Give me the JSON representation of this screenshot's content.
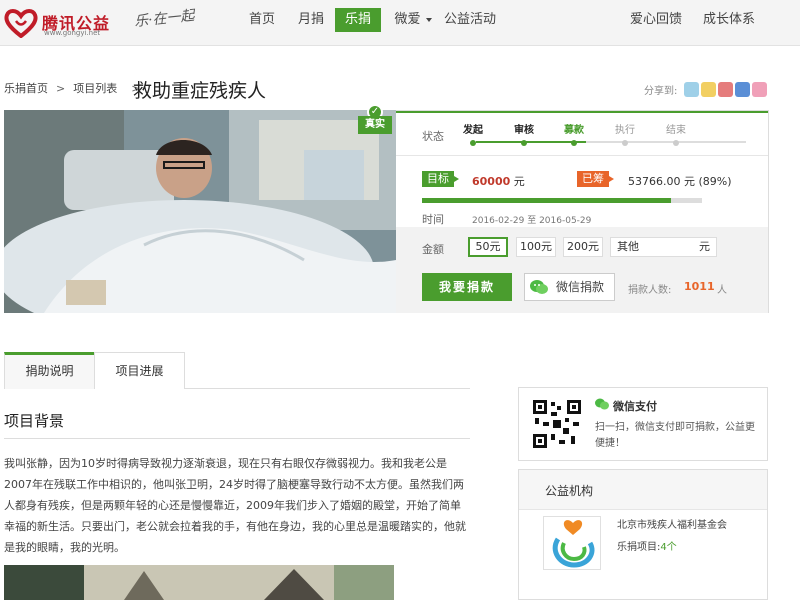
{
  "brand": {
    "logo_main": "腾讯公益",
    "logo_url": "www.gongyi.net",
    "slogan": "乐·在一起",
    "colors": {
      "accent": "#4a9d2e",
      "brand_red": "#c01c28",
      "orange": "#e8652a"
    }
  },
  "nav": {
    "items": [
      {
        "label": "首页"
      },
      {
        "label": "月捐"
      },
      {
        "label": "乐捐"
      },
      {
        "label": "微爱"
      },
      {
        "label": "公益活动"
      }
    ],
    "active": "乐捐",
    "right": [
      {
        "label": "爱心回馈"
      },
      {
        "label": "成长体系"
      }
    ]
  },
  "breadcrumb": {
    "home": "乐捐首页",
    "list": "项目列表",
    "separator": ">",
    "sep_main": ">"
  },
  "page_title": "救助重症残疾人",
  "share": {
    "label": "分享到:",
    "icons": [
      "qq-icon",
      "qzone-icon",
      "weibo-icon",
      "renren-icon",
      "kaixin-icon"
    ]
  },
  "verified_label": "真实",
  "status": {
    "label": "状态",
    "steps": [
      {
        "label": "发起",
        "state": "done"
      },
      {
        "label": "审核",
        "state": "done"
      },
      {
        "label": "募款",
        "state": "current"
      },
      {
        "label": "执行",
        "state": "todo"
      },
      {
        "label": "结束",
        "state": "todo"
      }
    ]
  },
  "funding": {
    "goal_tag": "目标",
    "goal_amount": "60000",
    "goal_unit": "元",
    "raised_tag": "已筹",
    "raised_text": "53766.00 元 (89%)",
    "progress_percent": 89,
    "time_label": "时间",
    "start_date": "2016-02-29",
    "to_word": "至",
    "end_date": "2016-05-29"
  },
  "donate": {
    "amount_label": "金额",
    "amounts": [
      "50元",
      "100元",
      "200元"
    ],
    "selected": "50元",
    "other_label": "其他",
    "other_unit": "元",
    "donate_button": "我要捐款",
    "wechat_button": "微信捐款",
    "donors_label": "捐款人数:",
    "donors_count": "1011",
    "donors_unit": "人"
  },
  "tabs": [
    {
      "label": "捐助说明",
      "active": true
    },
    {
      "label": "项目进展",
      "active": false
    }
  ],
  "section": {
    "title": "项目背景",
    "body": "我叫张静，因为10岁时得病导致视力逐渐衰退，现在只有右眼仅存微弱视力。我和我老公是2007年在残联工作中相识的，他叫张卫明，24岁时得了脑梗塞导致行动不太方便。虽然我们两人都身有残疾，但是两颗年轻的心还是慢慢靠近，2009年我们步入了婚姻的殿堂，开始了简单幸福的新生活。只要出门，老公就会拉着我的手，有他在身边，我的心里总是温暖踏实的，他就是我的眼睛，我的光明。"
  },
  "wechat_pay": {
    "title": "微信支付",
    "desc": "扫一扫，微信支付即可捐款，公益更便捷！"
  },
  "org": {
    "title": "公益机构",
    "name": "北京市残疾人福利基金会",
    "projects_label": "乐捐项目:",
    "projects_count": "4个"
  }
}
